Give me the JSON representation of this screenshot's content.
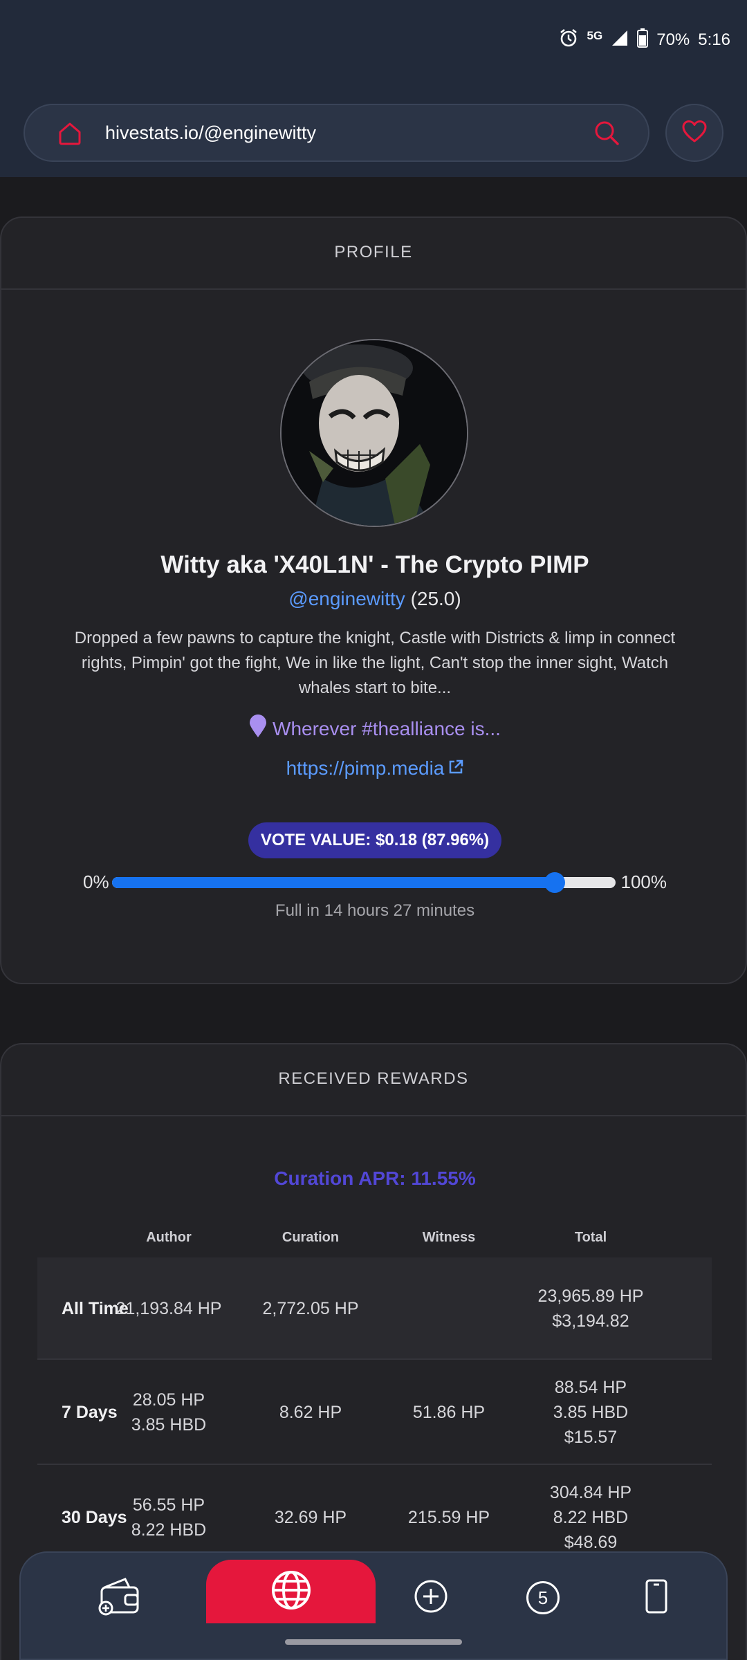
{
  "status_bar": {
    "network": "5G",
    "battery": "70%",
    "time": "5:16"
  },
  "browser": {
    "url": "hivestats.io/@enginewitty"
  },
  "profile": {
    "section_title": "PROFILE",
    "display_name": "Witty aka 'X40L1N' - The Crypto PIMP",
    "handle": "@enginewitty",
    "reputation": "(25.0)",
    "bio": "Dropped a few pawns to capture the knight, Castle with Districts & limp in connect rights, Pimpin' got the fight, We in like the light, Can't stop the inner sight, Watch whales start to bite...",
    "location": "Wherever #thealliance is...",
    "website": "https://pimp.media",
    "vote_value": "VOTE VALUE: $0.18 (87.96%)",
    "slider_min": "0%",
    "slider_max": "100%",
    "voting_power_fraction": 0.8796,
    "full_in": "Full in 14 hours 27 minutes"
  },
  "rewards": {
    "section_title": "RECEIVED REWARDS",
    "curation_apr": "Curation APR: 11.55%",
    "columns": [
      "Author",
      "Curation",
      "Witness",
      "Total"
    ],
    "rows": [
      {
        "label": "All Time",
        "author": [
          "21,193.84 HP"
        ],
        "curation": [
          "2,772.05 HP"
        ],
        "witness": [],
        "total": [
          "23,965.89 HP",
          "$3,194.82"
        ]
      },
      {
        "label": "7 Days",
        "author": [
          "28.05 HP",
          "3.85 HBD"
        ],
        "curation": [
          "8.62 HP"
        ],
        "witness": [
          "51.86 HP"
        ],
        "total": [
          "88.54 HP",
          "3.85 HBD",
          "$15.57"
        ]
      },
      {
        "label": "30 Days",
        "author": [
          "56.55 HP",
          "8.22 HBD"
        ],
        "curation": [
          "32.69 HP"
        ],
        "witness": [
          "215.59 HP"
        ],
        "total": [
          "304.84 HP",
          "8.22 HBD",
          "$48.69"
        ]
      }
    ]
  },
  "bottom_nav": {
    "items": [
      {
        "icon": "wallet-icon"
      },
      {
        "icon": "globe-icon"
      },
      {
        "icon": "plus-circle-icon"
      },
      {
        "icon": "tab-count-icon",
        "count": "5"
      },
      {
        "icon": "phone-icon"
      }
    ]
  },
  "colors": {
    "header_bg": "#222a3a",
    "accent_red": "#e5173c",
    "link_blue": "#5b9bff",
    "apr_purple": "#5247d6",
    "vote_pill": "#3530a0",
    "slider_fill": "#1672f0"
  }
}
